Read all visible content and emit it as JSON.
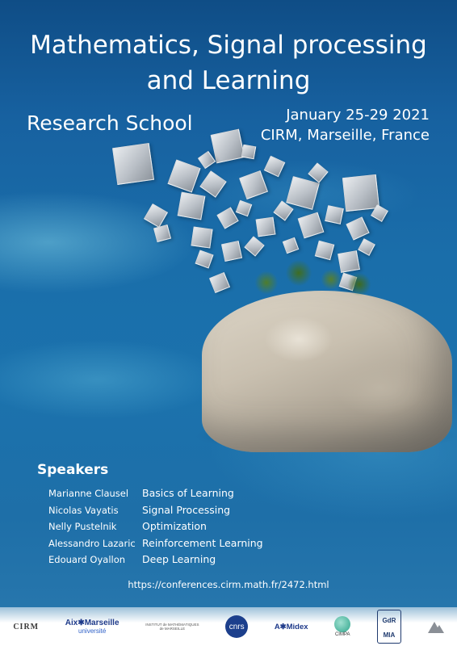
{
  "title_line1": "Mathematics, Signal processing",
  "title_line2": "and Learning",
  "subtitle": "Research School",
  "dates": "January 25-29 2021",
  "location": "CIRM, Marseille, France",
  "speakers_heading": "Speakers",
  "speakers": [
    {
      "name": "Marianne Clausel",
      "topic": "Basics of Learning"
    },
    {
      "name": "Nicolas Vayatis",
      "topic": "Signal Processing"
    },
    {
      "name": "Nelly Pustelnik",
      "topic": "Optimization"
    },
    {
      "name": "Alessandro Lazaric",
      "topic": "Reinforcement Learning"
    },
    {
      "name": "Edouard Oyallon",
      "topic": "Deep Learning"
    }
  ],
  "url": "https://conferences.cirm.math.fr/2472.html",
  "logos": [
    {
      "main": "CIRM",
      "sub": ""
    },
    {
      "main": "Aix✱Marseille",
      "sub": "université"
    },
    {
      "main": "INSTITUT de MATHÉMATIQUES",
      "sub": "de MARSEILLE"
    },
    {
      "main": "cnrs",
      "sub": ""
    },
    {
      "main": "A✱Midex",
      "sub": ""
    },
    {
      "main": "CIMPA",
      "sub": ""
    },
    {
      "main": "GdR MIA",
      "sub": ""
    },
    {
      "main": "",
      "sub": ""
    }
  ],
  "colors": {
    "sea": "#1a6eaa",
    "text": "#ffffff",
    "logo_navy": "#23306b"
  }
}
